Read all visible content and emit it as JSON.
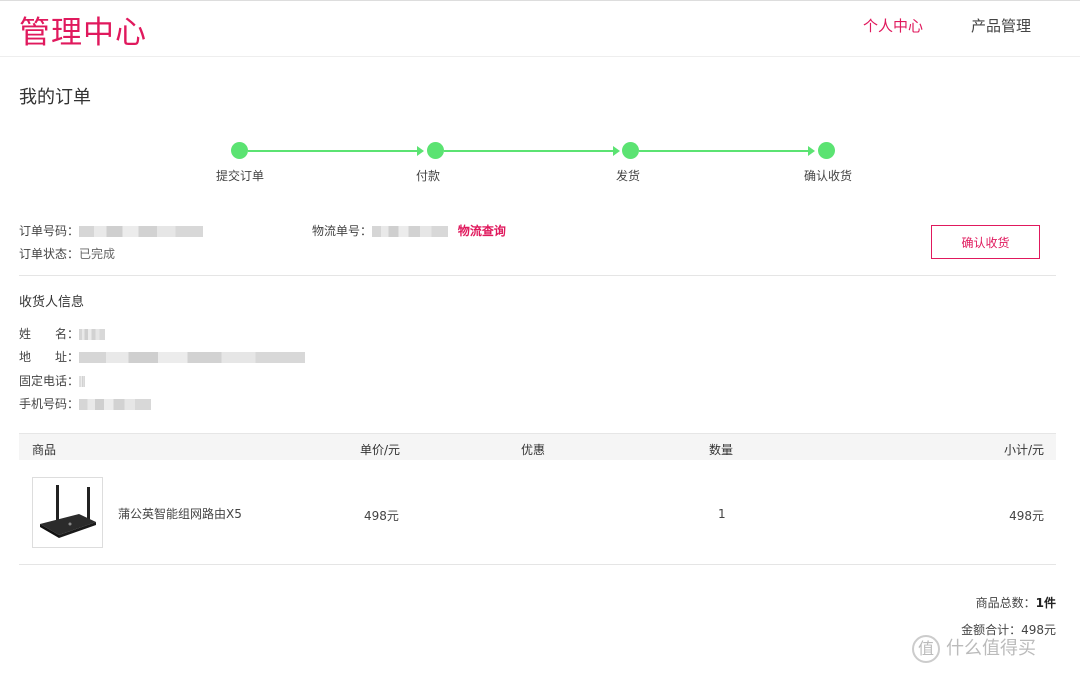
{
  "header": {
    "brand": "管理中心",
    "nav": [
      {
        "label": "个人中心",
        "active": true
      },
      {
        "label": "产品管理",
        "active": false
      }
    ]
  },
  "page_title": "我的订单",
  "steps": [
    "提交订单",
    "付款",
    "发货",
    "确认收货"
  ],
  "order": {
    "number_label": "订单号码：",
    "status_label": "订单状态：",
    "status_value": "已完成",
    "tracking_label": "物流单号：",
    "tracking_link": "物流查询",
    "confirm_button": "确认收货"
  },
  "recipient": {
    "title": "收货人信息",
    "name_label": "姓　　名：",
    "address_label": "地　　址：",
    "phone_label": "固定电话：",
    "mobile_label": "手机号码："
  },
  "table": {
    "headers": {
      "product": "商品",
      "price": "单价/元",
      "discount": "优惠",
      "qty": "数量",
      "subtotal": "小计/元"
    },
    "rows": [
      {
        "name": "蒲公英智能组网路由X5",
        "price": "498元",
        "qty": "1",
        "subtotal": "498元"
      }
    ]
  },
  "summary": {
    "count_label": "商品总数：",
    "count_value": "1件",
    "total_label": "金额合计：",
    "total_value": "498元"
  },
  "watermark": {
    "icon": "值",
    "text": "什么值得买"
  },
  "colors": {
    "accent": "#e0195d",
    "step_green": "#5be372"
  }
}
